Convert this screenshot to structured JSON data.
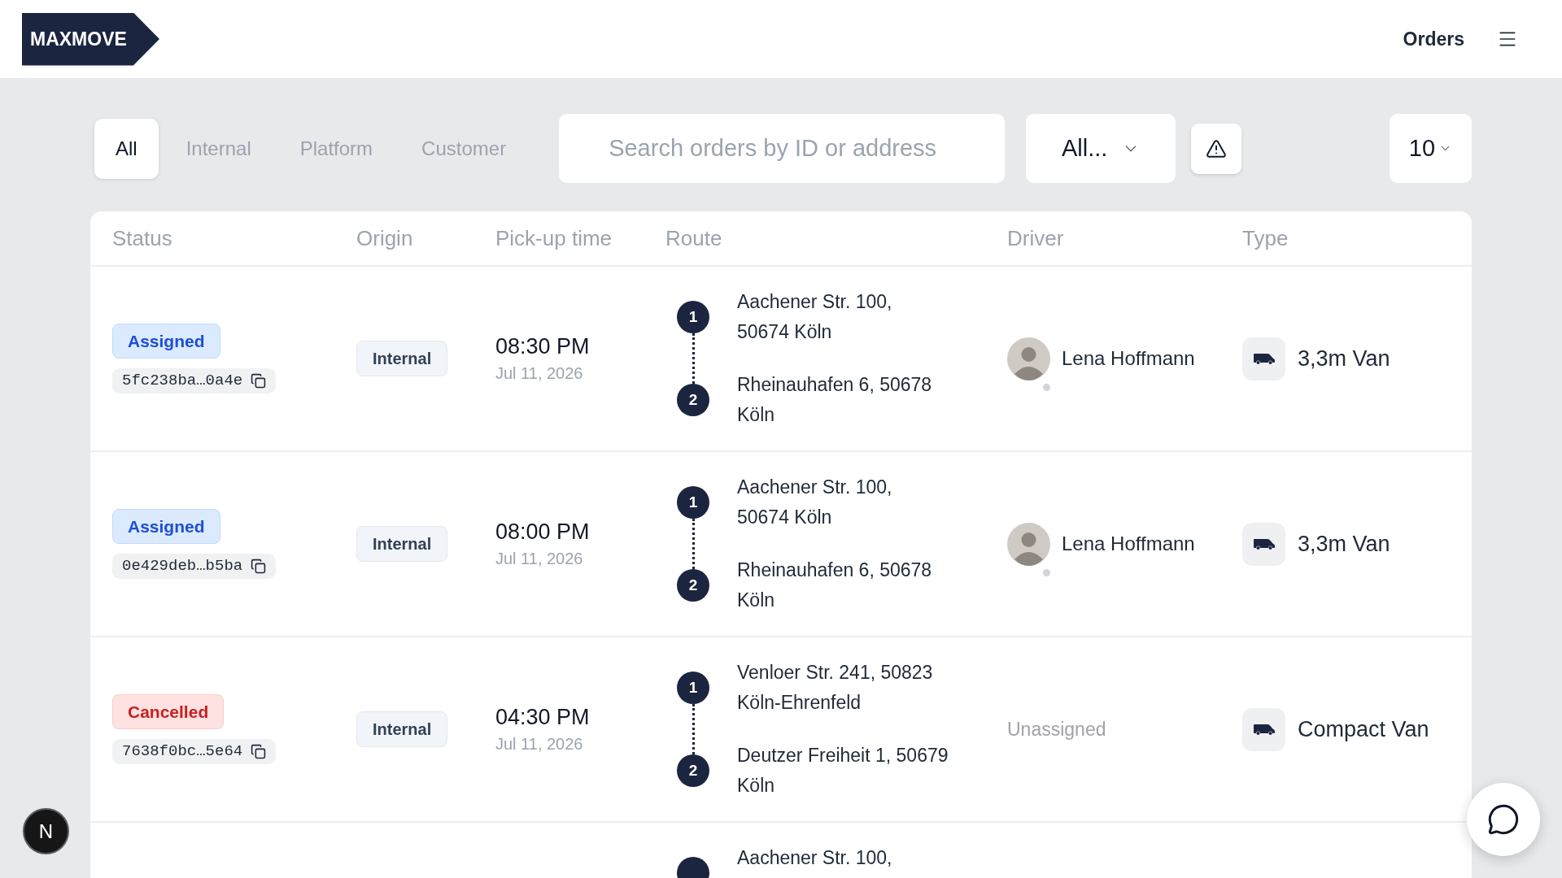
{
  "header": {
    "logo": "MAXMOVE",
    "nav_link": "Orders"
  },
  "tabs": [
    {
      "label": "All",
      "selected": true
    },
    {
      "label": "Internal",
      "selected": false
    },
    {
      "label": "Platform",
      "selected": false
    },
    {
      "label": "Customer",
      "selected": false
    }
  ],
  "search": {
    "placeholder": "Search orders by ID or address"
  },
  "status_filter": {
    "value": "All..."
  },
  "page_size": {
    "value": "10"
  },
  "table": {
    "columns": [
      "Status",
      "Origin",
      "Pick-up time",
      "Route",
      "Driver",
      "Type"
    ],
    "rows": [
      {
        "status": {
          "kind": "assigned",
          "label": "Assigned"
        },
        "order_id": "5fc238ba…0a4e",
        "origin": "Internal",
        "pickup_time": "08:30 PM",
        "pickup_date": "Jul 11, 2026",
        "route": [
          {
            "number": "1",
            "lines": [
              "Aachener Str. 100,",
              "50674 Köln"
            ]
          },
          {
            "number": "2",
            "lines": [
              "Rheinauhafen 6, 50678",
              "Köln"
            ]
          }
        ],
        "driver": {
          "kind": "assigned",
          "name": "Lena Hoffmann",
          "online": false
        },
        "vehicle_type": "3,3m Van"
      },
      {
        "status": {
          "kind": "assigned",
          "label": "Assigned"
        },
        "order_id": "0e429deb…b5ba",
        "origin": "Internal",
        "pickup_time": "08:00 PM",
        "pickup_date": "Jul 11, 2026",
        "route": [
          {
            "number": "1",
            "lines": [
              "Aachener Str. 100,",
              "50674 Köln"
            ]
          },
          {
            "number": "2",
            "lines": [
              "Rheinauhafen 6, 50678",
              "Köln"
            ]
          }
        ],
        "driver": {
          "kind": "assigned",
          "name": "Lena Hoffmann",
          "online": false
        },
        "vehicle_type": "3,3m Van"
      },
      {
        "status": {
          "kind": "cancelled",
          "label": "Cancelled"
        },
        "order_id": "7638f0bc…5e64",
        "origin": "Internal",
        "pickup_time": "04:30 PM",
        "pickup_date": "Jul 11, 2026",
        "route": [
          {
            "number": "1",
            "lines": [
              "Venloer Str. 241, 50823",
              "Köln-Ehrenfeld"
            ]
          },
          {
            "number": "2",
            "lines": [
              "Deutzer Freiheit 1, 50679",
              "Köln"
            ]
          }
        ],
        "driver": {
          "kind": "unassigned",
          "label": "Unassigned"
        },
        "vehicle_type": "Compact Van"
      },
      {
        "route": [
          {
            "lines": [
              "Aachener Str. 100,"
            ]
          }
        ]
      }
    ]
  },
  "dev_badge": {
    "label": "N"
  }
}
